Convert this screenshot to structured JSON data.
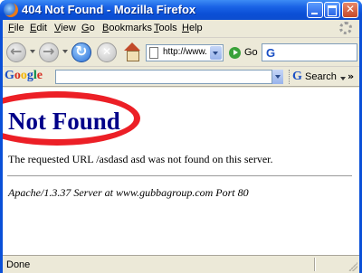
{
  "window": {
    "title": "404 Not Found - Mozilla Firefox",
    "icon": "firefox-icon"
  },
  "menu": {
    "items": [
      "File",
      "Edit",
      "View",
      "Go",
      "Bookmarks",
      "Tools",
      "Help"
    ]
  },
  "navigation": {
    "url": "http://www.",
    "go_label": "Go",
    "search_icon_label": "G"
  },
  "google_toolbar": {
    "logo_letters": [
      "G",
      "o",
      "o",
      "g",
      "l",
      "e"
    ],
    "logo_colors": [
      "#1a4fc4",
      "#d62d20",
      "#f4b400",
      "#1a4fc4",
      "#008744",
      "#d62d20"
    ],
    "search_icon_label": "G",
    "search_button_label": "Search",
    "more_chevron": "»"
  },
  "page": {
    "heading": "Not Found",
    "message": "The requested URL /asdasd asd was not found on this server.",
    "signature": "Apache/1.3.37 Server at www.gubbagroup.com Port 80",
    "annotation_color": "#ec1f26"
  },
  "status": {
    "text": "Done"
  }
}
